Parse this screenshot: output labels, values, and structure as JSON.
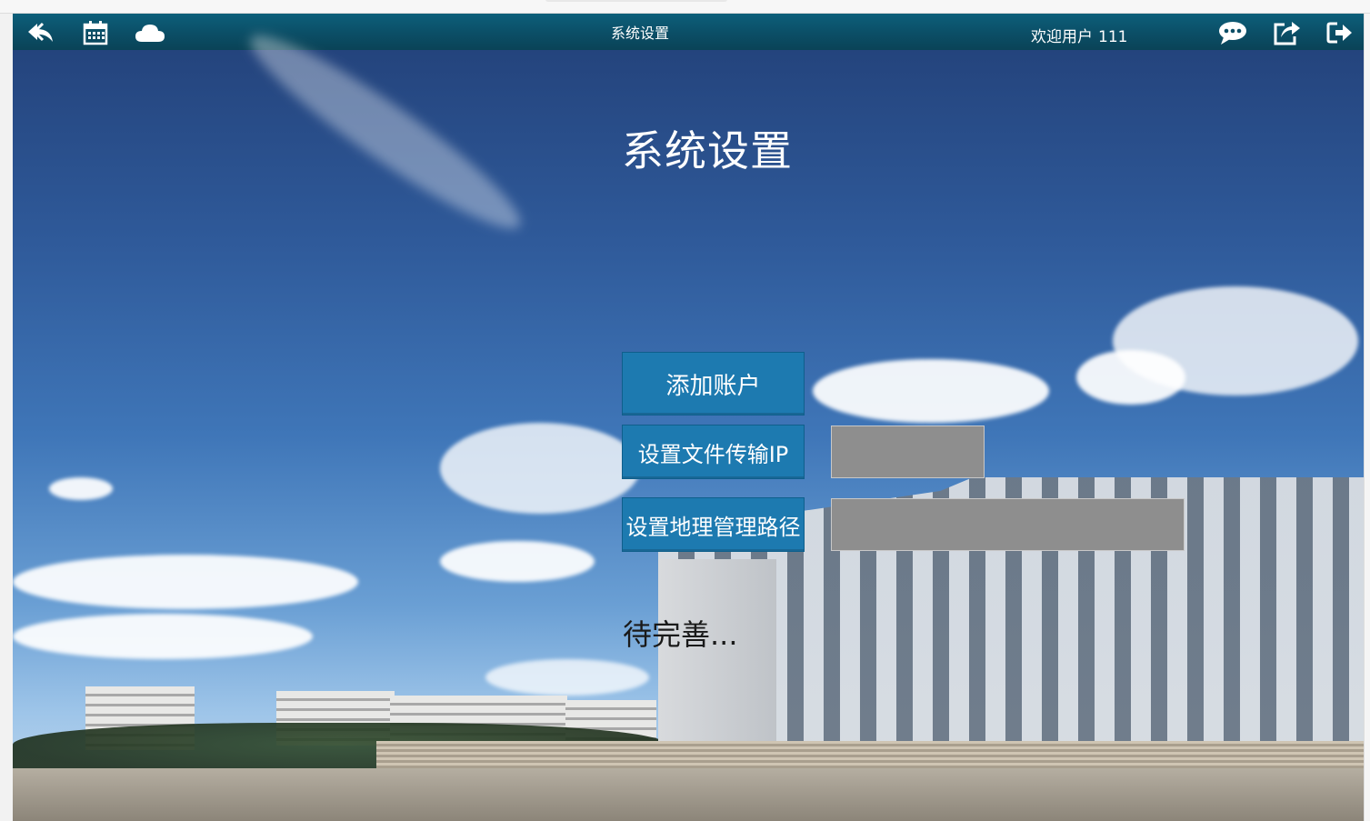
{
  "header": {
    "title": "系统设置",
    "welcome_label": "欢迎用户",
    "user_id": "111",
    "icons": [
      "back-icon",
      "calendar-icon",
      "cloud-icon",
      "chat-icon",
      "share-icon",
      "logout-icon"
    ]
  },
  "main": {
    "heading": "系统设置",
    "buttons": {
      "add_account": "添加账户",
      "set_transfer_ip": "设置文件传输IP",
      "set_geo_path": "设置地理管理路径"
    },
    "fields": {
      "transfer_ip_value": "",
      "geo_path_value": ""
    },
    "pending_text": "待完善..."
  },
  "colors": {
    "header": "#0b4e66",
    "button": "#1d7ab0",
    "field": "#8e8e8e"
  }
}
